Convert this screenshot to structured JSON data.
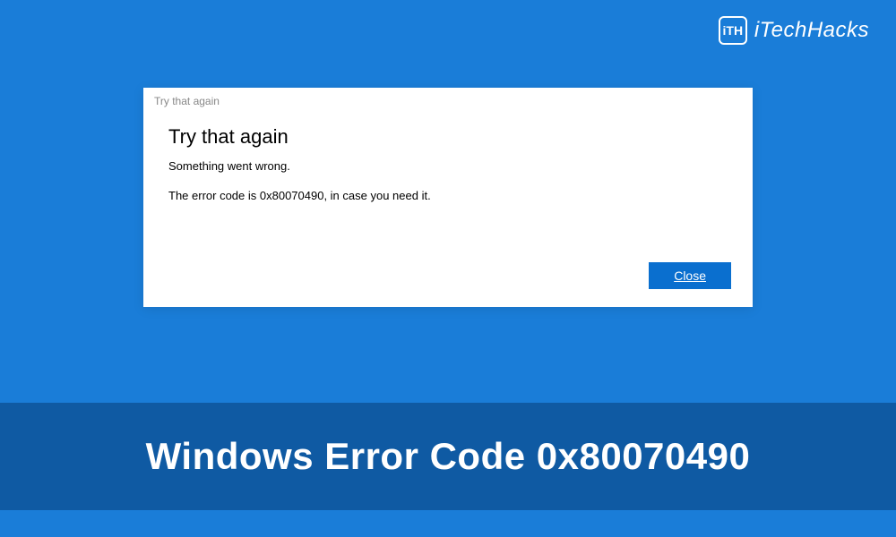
{
  "brand": {
    "logo_text": "iTH",
    "name": "iTechHacks"
  },
  "dialog": {
    "window_title": "Try that again",
    "heading": "Try that again",
    "message": "Something went wrong.",
    "detail": "The error code is 0x80070490, in case you need it.",
    "close_label": "Close"
  },
  "banner": {
    "text": "Windows Error Code 0x80070490"
  }
}
